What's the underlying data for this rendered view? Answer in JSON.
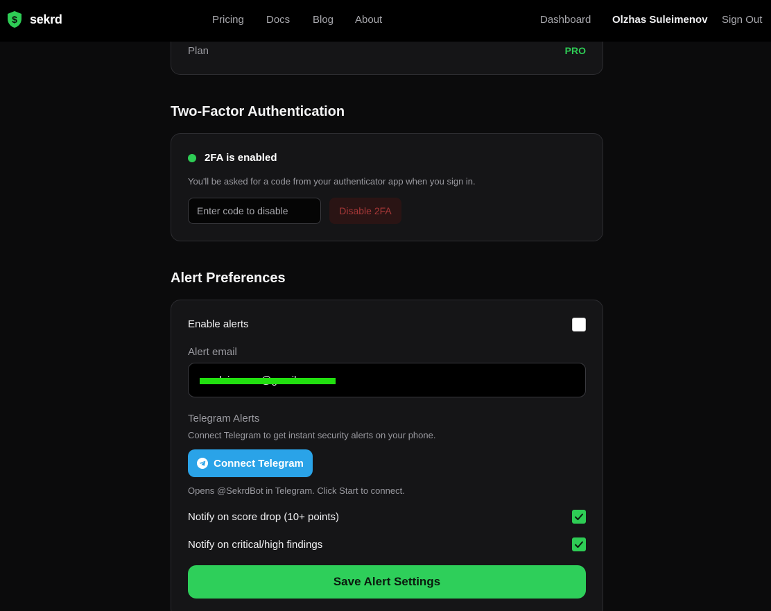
{
  "nav": {
    "brand": "sekrd",
    "links": [
      "Pricing",
      "Docs",
      "Blog",
      "About"
    ],
    "dashboard": "Dashboard",
    "user": "Olzhas Suleimenov",
    "signout": "Sign Out"
  },
  "plan": {
    "label": "Plan",
    "value": "PRO"
  },
  "tfa": {
    "title": "Two-Factor Authentication",
    "status": "2FA is enabled",
    "description": "You'll be asked for a code from your authenticator app when you sign in.",
    "code_placeholder": "Enter code to disable",
    "disable_label": "Disable 2FA"
  },
  "alerts": {
    "title": "Alert Preferences",
    "enable_label": "Enable alerts",
    "enable_checked": false,
    "email_label": "Alert email",
    "email_value": "o.suleimenov@gmail",
    "telegram_label": "Telegram Alerts",
    "telegram_description": "Connect Telegram to get instant security alerts on your phone.",
    "telegram_button": "Connect Telegram",
    "telegram_note": "Opens @SekrdBot in Telegram. Click Start to connect.",
    "score_drop_label": "Notify on score drop (10+ points)",
    "score_drop_checked": true,
    "critical_label": "Notify on critical/high findings",
    "critical_checked": true,
    "save_label": "Save Alert Settings"
  },
  "colors": {
    "accent": "#2ecc55",
    "telegram": "#2aa3e8",
    "danger": "#a83838",
    "redaction": "#22e010"
  },
  "icons": {
    "brand": "shield-dollar-icon",
    "telegram": "telegram-icon",
    "check": "checkmark-icon"
  }
}
